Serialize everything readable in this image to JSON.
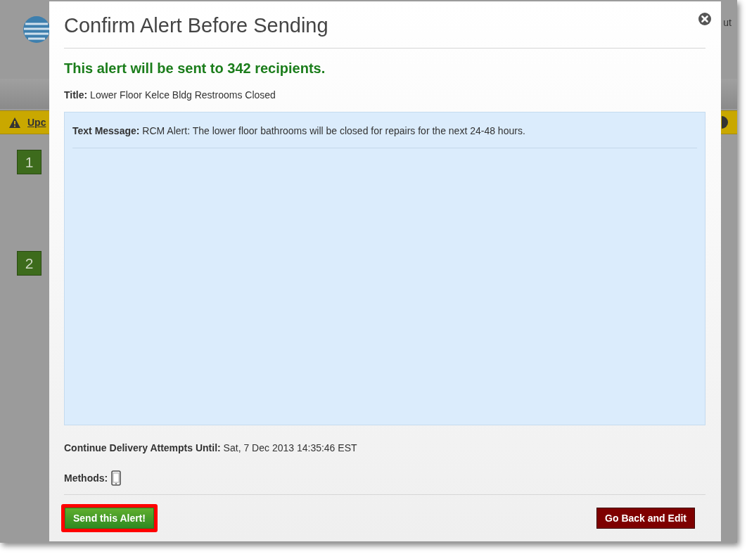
{
  "background_page": {
    "corner_text": "ut",
    "notice_bar": {
      "link": "Upc"
    },
    "steps": [
      "1",
      "2"
    ]
  },
  "dialog": {
    "title": "Confirm Alert Before Sending",
    "summary": "This alert will be sent to 342 recipients.",
    "alert_title": "**Title:** Lower Floor Kelce Bldg Restrooms Closed",
    "text_message": "**Text Message:** RCM Alert: The lower floor bathrooms will be closed for repairs for the next 24-48 hours.",
    "delivery_until": "**Continue Delivery Attempts Until:** Sat, 7 Dec 2013 14:35:46 EST",
    "methods": {
      "label": "Methods:",
      "items": [
        {
          "kind": "phone"
        }
      ]
    },
    "buttons": [
      {
        "label": "Send this Alert!",
        "kind": "primary",
        "highlighted": true
      },
      {
        "label": "Go Back and Edit",
        "kind": "danger",
        "highlighted": false
      }
    ]
  }
}
